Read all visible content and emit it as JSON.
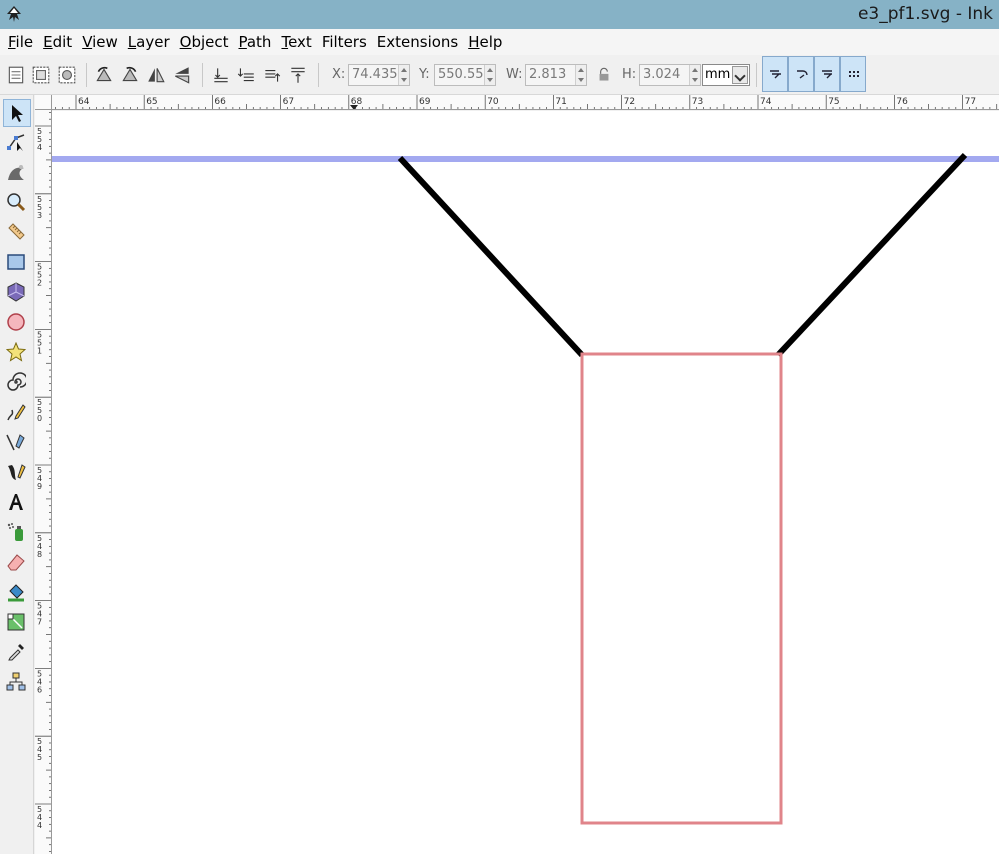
{
  "window": {
    "title": "e3_pf1.svg - Ink",
    "icon": "inkscape-logo-icon"
  },
  "menu": [
    {
      "label": "File",
      "accel": "F",
      "rest": "ile"
    },
    {
      "label": "Edit",
      "accel": "E",
      "rest": "dit"
    },
    {
      "label": "View",
      "accel": "V",
      "rest": "iew"
    },
    {
      "label": "Layer",
      "accel": "L",
      "rest": "ayer"
    },
    {
      "label": "Object",
      "accel": "O",
      "rest": "bject"
    },
    {
      "label": "Path",
      "accel": "P",
      "rest": "ath"
    },
    {
      "label": "Text",
      "accel": "T",
      "rest": "ext"
    },
    {
      "label": "Filters",
      "accel": "",
      "rest": "Filters"
    },
    {
      "label": "Extensions",
      "accel": "",
      "rest": "Extensions"
    },
    {
      "label": "Help",
      "accel": "H",
      "rest": "elp"
    }
  ],
  "selector_toolbar": {
    "x_label": "X:",
    "x_value": "74.435",
    "y_label": "Y:",
    "y_value": "550.552",
    "w_label": "W:",
    "w_value": "2.813",
    "h_label": "H:",
    "h_value": "3.024",
    "unit": "mm"
  },
  "ruler": {
    "horizontal_labels": [
      "64",
      "65",
      "66",
      "67",
      "68",
      "69",
      "70",
      "71",
      "72",
      "73",
      "74",
      "75",
      "76",
      "77"
    ],
    "vertical_labels": [
      "5 5 4",
      "5 5 3",
      "5 5 2",
      "5 5 1",
      "5 5 0",
      "5 4 9",
      "5 4 8",
      "5 4 7",
      "5 4 6",
      "5 4 5",
      "5 4 4"
    ]
  },
  "canvas": {
    "guide_color": "#a3a9f0",
    "stroke_color": "#000000",
    "rect_stroke_color": "#e0848a"
  },
  "colors": {
    "titlebar": "#86b2c6",
    "active_tool": "#cde4f7"
  }
}
